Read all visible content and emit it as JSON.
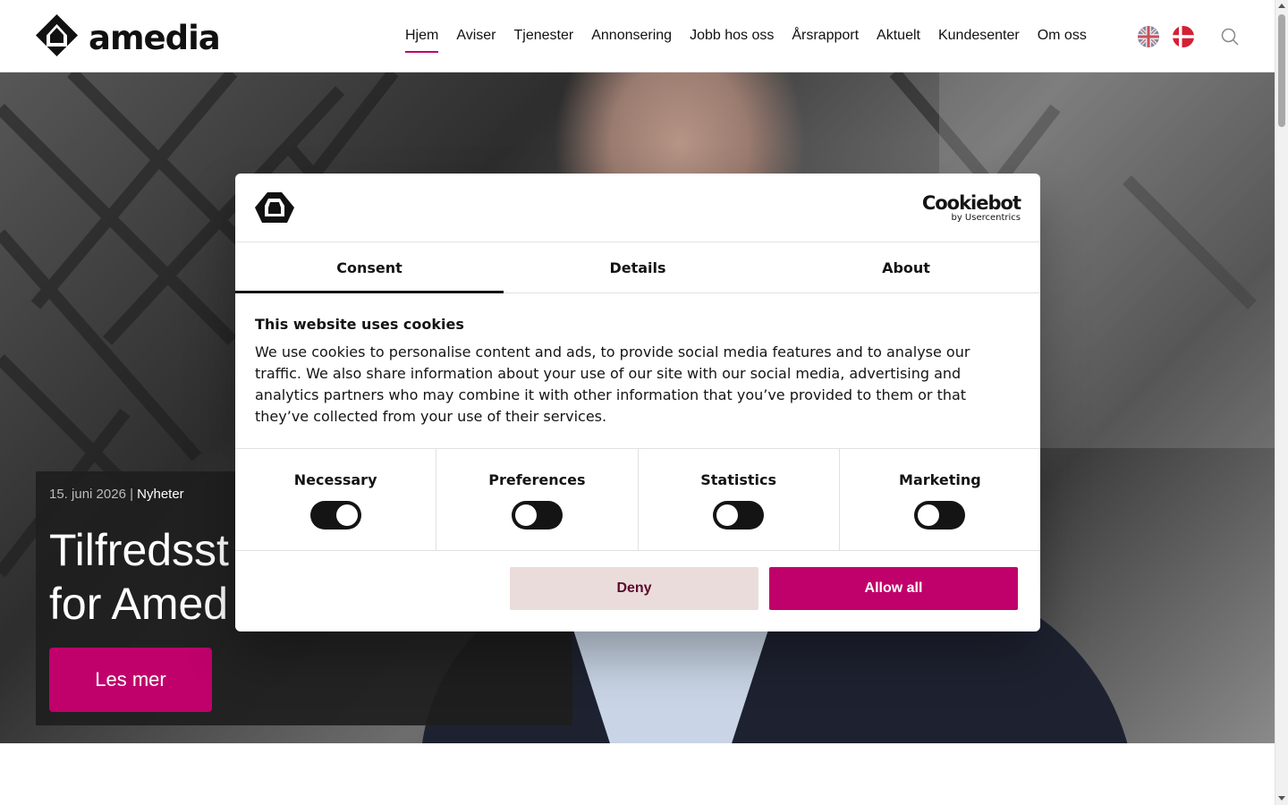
{
  "site": {
    "logo_text": "amedia",
    "logo_icon": "amedia-logo-icon"
  },
  "nav": {
    "items": [
      {
        "label": "Hjem",
        "active": true
      },
      {
        "label": "Aviser"
      },
      {
        "label": "Tjenester"
      },
      {
        "label": "Annonsering"
      },
      {
        "label": "Jobb hos oss"
      },
      {
        "label": "Årsrapport"
      },
      {
        "label": "Aktuelt"
      },
      {
        "label": "Kundesenter"
      },
      {
        "label": "Om oss"
      }
    ],
    "language_flags": [
      "uk-flag-icon",
      "dk-flag-icon"
    ],
    "search_icon": "search-icon"
  },
  "hero": {
    "date": "15. juni 2026",
    "separator": " | ",
    "category": "Nyheter",
    "title_line1": "Tilfredsst",
    "title_line2": "for Amed",
    "button_label": "Les mer"
  },
  "cookie_dialog": {
    "brand": "Cookiebot",
    "brand_sub": "by Usercentrics",
    "tabs": [
      {
        "label": "Consent",
        "active": true
      },
      {
        "label": "Details"
      },
      {
        "label": "About"
      }
    ],
    "heading": "This website uses cookies",
    "text": "We use cookies to personalise content and ads, to provide social media features and to analyse our traffic. We also share information about your use of our site with our social media, advertising and analytics partners who may combine it with other information that you’ve provided to them or that they’ve collected from your use of their services.",
    "categories": [
      {
        "label": "Necessary",
        "enabled": true
      },
      {
        "label": "Preferences",
        "enabled": false
      },
      {
        "label": "Statistics",
        "enabled": false
      },
      {
        "label": "Marketing",
        "enabled": false
      }
    ],
    "deny_label": "Deny",
    "allow_label": "Allow all"
  },
  "colors": {
    "accent": "#c0006b",
    "deny_bg": "#ebdcdc",
    "dark": "#141414"
  }
}
